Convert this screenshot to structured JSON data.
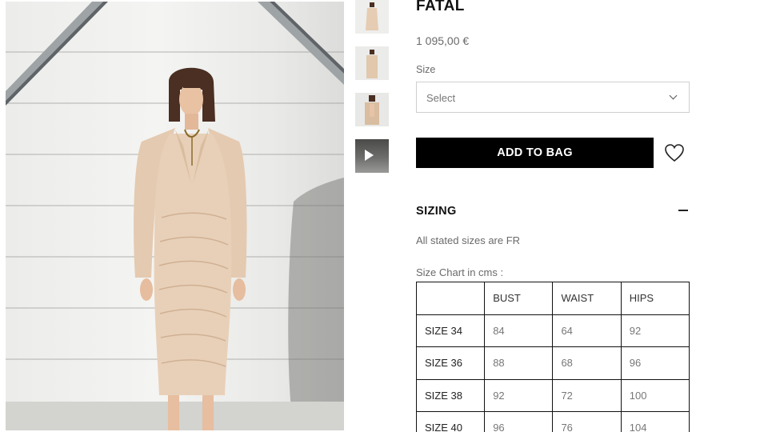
{
  "product": {
    "title": "FATAL",
    "price": "1 095,00 €",
    "size_label": "Size",
    "size_select": {
      "value": "Select"
    },
    "add_to_bag_label": "ADD TO BAG"
  },
  "sizing": {
    "title": "SIZING",
    "note": "All stated sizes are FR",
    "chart_caption": "Size Chart in cms :",
    "table": {
      "headers": [
        "",
        "BUST",
        "WAIST",
        "HIPS"
      ],
      "rows": [
        [
          "SIZE 34",
          "84",
          "64",
          "92"
        ],
        [
          "SIZE 36",
          "88",
          "68",
          "96"
        ],
        [
          "SIZE 38",
          "92",
          "72",
          "100"
        ],
        [
          "SIZE 40",
          "96",
          "76",
          "104"
        ]
      ]
    }
  },
  "icons": {
    "select": "chevron-down-icon",
    "wishlist": "heart-icon",
    "collapse": "minus-icon",
    "video_thumb": "play-icon"
  },
  "colors": {
    "button_bg": "#000000",
    "button_text": "#ffffff",
    "muted_text": "#6a6a6a",
    "dress": "#e6cdb4"
  }
}
